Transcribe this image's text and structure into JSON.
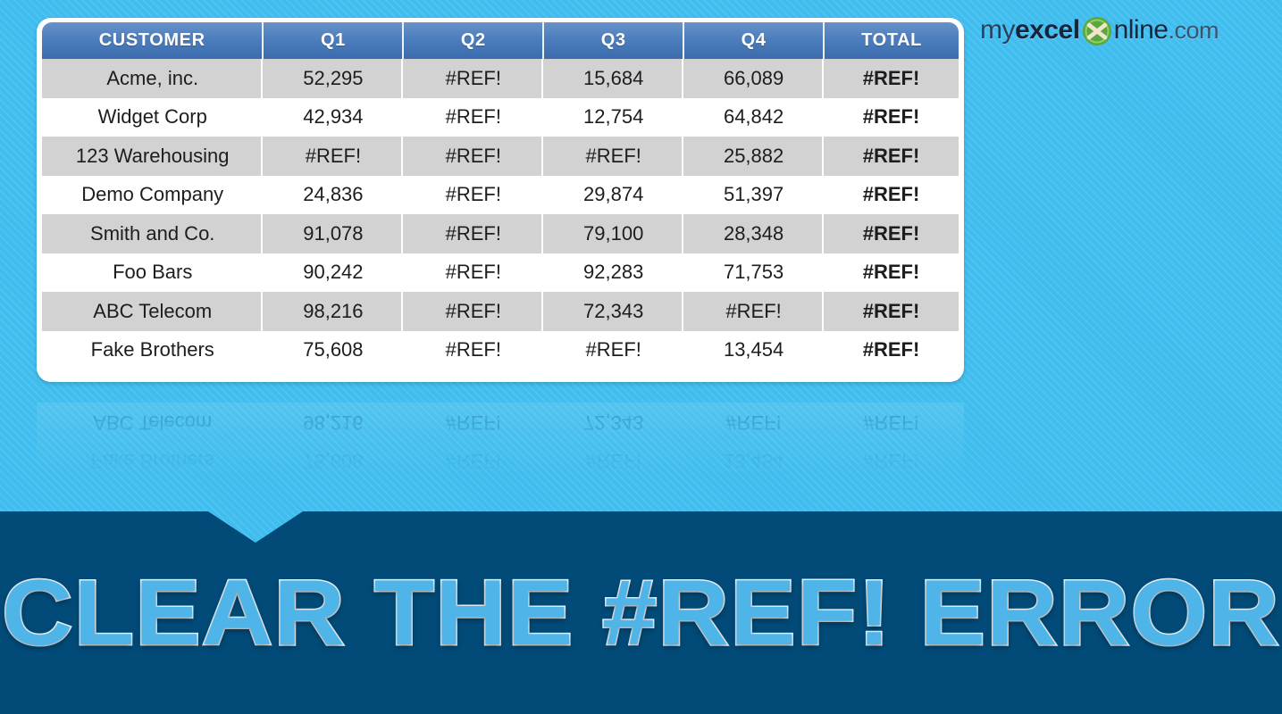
{
  "brand": {
    "logo_my": "my",
    "logo_excel": "excel",
    "logo_icon": "excel-x-circle-icon",
    "logo_nline": "nline",
    "logo_com": ".com",
    "accent_light_blue": "#3fbdee",
    "accent_dark_blue": "#024a77",
    "header_blue": "#4d7ebc",
    "banner_text_fill": "#4fb4e8",
    "banner_text_outline": "#eaf6fd",
    "logo_icon_green": "#5aa83c"
  },
  "banner": {
    "headline": "CLEAR THE #REF! ERROR"
  },
  "table": {
    "columns": [
      "CUSTOMER",
      "Q1",
      "Q2",
      "Q3",
      "Q4",
      "TOTAL"
    ],
    "error_value": "#REF!",
    "rows": [
      {
        "customer": "Acme, inc.",
        "q1": "52,295",
        "q2": "#REF!",
        "q3": "15,684",
        "q4": "66,089",
        "total": "#REF!",
        "shaded": true
      },
      {
        "customer": "Widget Corp",
        "q1": "42,934",
        "q2": "#REF!",
        "q3": "12,754",
        "q4": "64,842",
        "total": "#REF!",
        "shaded": false
      },
      {
        "customer": "123 Warehousing",
        "q1": "#REF!",
        "q2": "#REF!",
        "q3": "#REF!",
        "q4": "25,882",
        "total": "#REF!",
        "shaded": true
      },
      {
        "customer": "Demo Company",
        "q1": "24,836",
        "q2": "#REF!",
        "q3": "29,874",
        "q4": "51,397",
        "total": "#REF!",
        "shaded": false
      },
      {
        "customer": "Smith and Co.",
        "q1": "91,078",
        "q2": "#REF!",
        "q3": "79,100",
        "q4": "28,348",
        "total": "#REF!",
        "shaded": true
      },
      {
        "customer": "Foo Bars",
        "q1": "90,242",
        "q2": "#REF!",
        "q3": "92,283",
        "q4": "71,753",
        "total": "#REF!",
        "shaded": false
      },
      {
        "customer": "ABC Telecom",
        "q1": "98,216",
        "q2": "#REF!",
        "q3": "72,343",
        "q4": "#REF!",
        "total": "#REF!",
        "shaded": true
      },
      {
        "customer": "Fake Brothers",
        "q1": "75,608",
        "q2": "#REF!",
        "q3": "#REF!",
        "q4": "13,454",
        "total": "#REF!",
        "shaded": false
      }
    ]
  },
  "reflection": {
    "rows": [
      {
        "customer": "Fake Brothers",
        "q1": "75,608",
        "q2": "#REF!",
        "q3": "#REF!",
        "q4": "13,454",
        "total": "#REF!"
      },
      {
        "customer": "ABC Telecom",
        "q1": "98,216",
        "q2": "#REF!",
        "q3": "72,343",
        "q4": "#REF!",
        "total": "#REF!"
      }
    ]
  }
}
